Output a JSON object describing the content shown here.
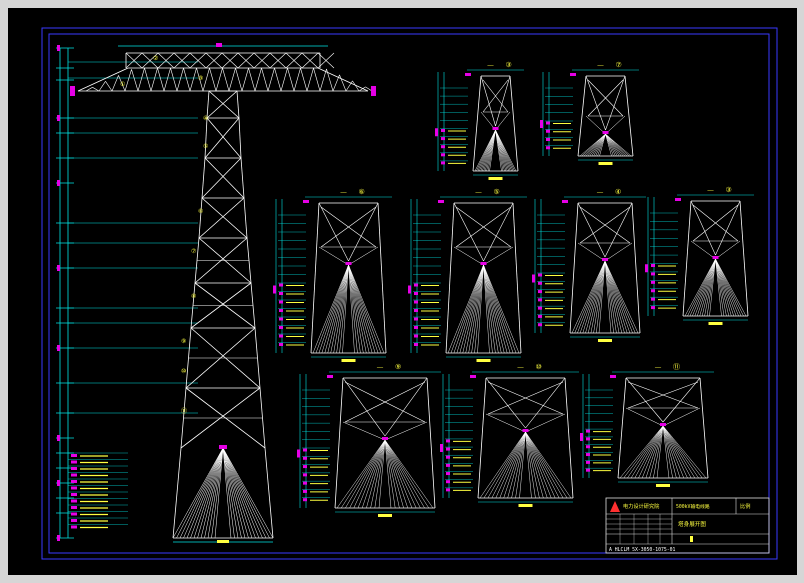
{
  "drawing": {
    "colors": {
      "background": "#000000",
      "frame": "#3a3aff",
      "tower": "#ffffff",
      "dimension": "#00e5e5",
      "marker": "#e600e6",
      "label": "#ffff40",
      "title_red": "#ff3030"
    },
    "main_elevation": {
      "labels": [
        "①",
        "②",
        "③",
        "④",
        "⑤",
        "⑥",
        "⑦",
        "⑧",
        "⑨",
        "⑩",
        "⑪"
      ]
    },
    "section_views": [
      {
        "id": "s1",
        "label": "③"
      },
      {
        "id": "s2",
        "label": "⑦"
      },
      {
        "id": "s3",
        "label": "⑥"
      },
      {
        "id": "s4",
        "label": "⑤"
      },
      {
        "id": "s5",
        "label": "④"
      },
      {
        "id": "s6",
        "label": "③"
      },
      {
        "id": "s7",
        "label": "⑨"
      },
      {
        "id": "s8",
        "label": "⑩"
      },
      {
        "id": "s9",
        "label": "⑪"
      }
    ],
    "title_block": {
      "company": "电力设计研究院",
      "project": "500kV输电线路",
      "drawing_name": "塔身展开图",
      "scale_label": "比例",
      "drawing_number": "A HLCLM 5X-3050-1075-01"
    }
  }
}
